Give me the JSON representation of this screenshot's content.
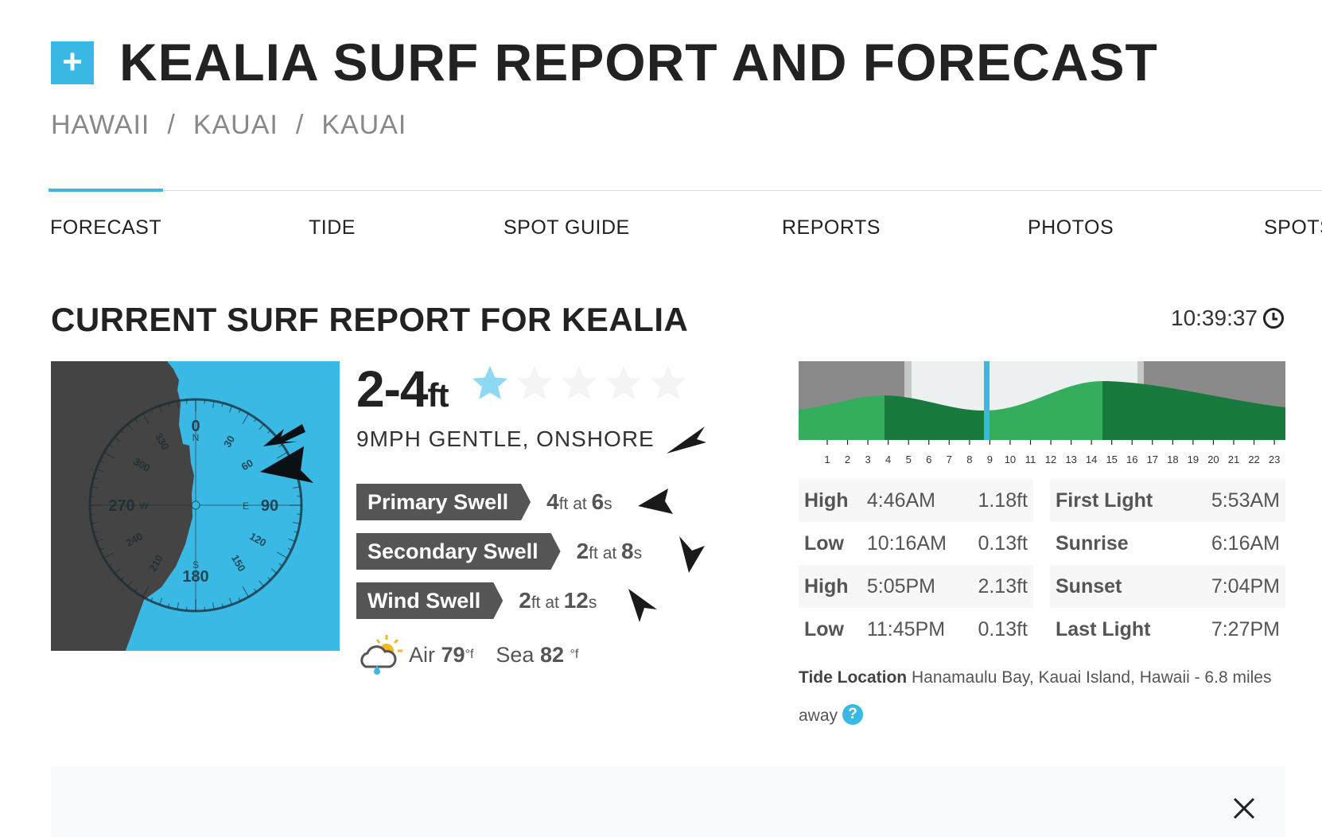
{
  "header": {
    "logo_glyph": "+",
    "title": "KEALIA SURF REPORT AND FORECAST",
    "breadcrumb": [
      "HAWAII",
      "KAUAI",
      "KAUAI"
    ],
    "breadcrumb_sep": "/"
  },
  "nav": {
    "tabs": [
      {
        "label": "FORECAST",
        "active": true
      },
      {
        "label": "TIDE"
      },
      {
        "label": "SPOT GUIDE"
      },
      {
        "label": "REPORTS"
      },
      {
        "label": "PHOTOS"
      },
      {
        "label": "SPOTS"
      }
    ]
  },
  "report": {
    "heading": "CURRENT SURF REPORT FOR KEALIA",
    "time": "10:39:37",
    "clock_icon": "clock-icon",
    "height_value": "2-4",
    "height_unit": "ft",
    "rating": 1,
    "rating_max": 5,
    "wind": "9MPH GENTLE, ONSHORE",
    "compass_labels": {
      "n": "0",
      "n_letter": "N",
      "e": "90",
      "e_letter": "E",
      "s": "180",
      "s_letter": "S",
      "w": "270",
      "w_letter": "W",
      "l30": "30",
      "l60": "60",
      "l120": "120",
      "l150": "150",
      "l210": "210",
      "l240": "240",
      "l300": "300",
      "l330": "330"
    },
    "swells": [
      {
        "label": "Primary Swell",
        "height": "4",
        "height_unit": "ft",
        "at": "at",
        "period": "6",
        "period_unit": "s"
      },
      {
        "label": "Secondary Swell",
        "height": "2",
        "height_unit": "ft",
        "at": "at",
        "period": "8",
        "period_unit": "s"
      },
      {
        "label": "Wind Swell",
        "height": "2",
        "height_unit": "ft",
        "at": "at",
        "period": "12",
        "period_unit": "s"
      }
    ],
    "weather": {
      "icon": "cloud-sun-rain-icon",
      "air_label": "Air",
      "air": "79",
      "air_unit": "°f",
      "sea_label": "Sea",
      "sea": "82",
      "sea_unit": "°f"
    }
  },
  "tide": {
    "hour_labels": [
      "1",
      "2",
      "3",
      "4",
      "5",
      "6",
      "7",
      "8",
      "9",
      "10",
      "11",
      "12",
      "13",
      "14",
      "15",
      "16",
      "17",
      "18",
      "19",
      "20",
      "21",
      "22",
      "23"
    ],
    "colors": {
      "night": "#8a8a8a",
      "twilight": "#c8c8c8",
      "day": "#ecf0f1",
      "tide_rising": "#34ad5c",
      "tide_falling": "#187a3c",
      "now": "#39b8e4"
    },
    "tides": [
      {
        "type": "High",
        "time": "4:46AM",
        "height": "1.18ft"
      },
      {
        "type": "Low",
        "time": "10:16AM",
        "height": "0.13ft"
      },
      {
        "type": "High",
        "time": "5:05PM",
        "height": "2.13ft"
      },
      {
        "type": "Low",
        "time": "11:45PM",
        "height": "0.13ft"
      }
    ],
    "sun": [
      {
        "label": "First Light",
        "time": "5:53AM"
      },
      {
        "label": "Sunrise",
        "time": "6:16AM"
      },
      {
        "label": "Sunset",
        "time": "7:04PM"
      },
      {
        "label": "Last Light",
        "time": "7:27PM"
      }
    ],
    "location_label": "Tide Location",
    "location": "Hanamaulu Bay, Kauai Island, Hawaii - 6.8 miles away",
    "help_glyph": "?"
  }
}
